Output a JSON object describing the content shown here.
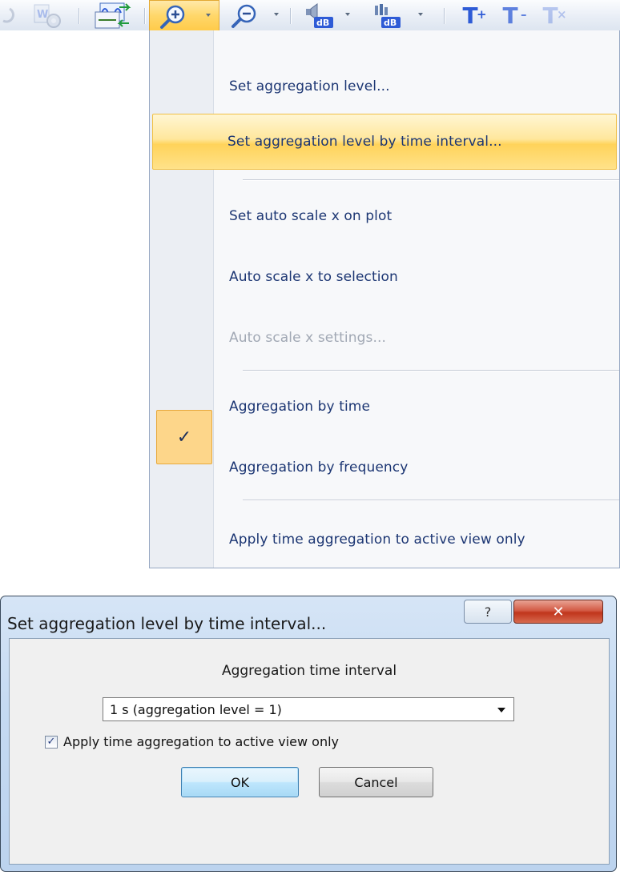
{
  "menu": {
    "items": [
      {
        "label": "Set aggregation level..."
      },
      {
        "label": "Set aggregation level by time interval..."
      },
      {
        "label": "Set auto scale x on plot"
      },
      {
        "label": "Auto scale x to selection"
      },
      {
        "label": "Auto scale x settings..."
      },
      {
        "label": "Aggregation by time"
      },
      {
        "label": "Aggregation by frequency"
      },
      {
        "label": "Apply time aggregation to active view only"
      }
    ],
    "checked_glyph": "✓"
  },
  "dialog": {
    "title": "Set aggregation level by time interval...",
    "help_glyph": "?",
    "close_glyph": "✕",
    "interval_label": "Aggregation time interval",
    "combo_value": "1 s (aggregation level = 1)",
    "checkbox_label": "Apply time aggregation to active view only",
    "checkbox_checked": true,
    "checkbox_glyph": "✓",
    "ok_label": "OK",
    "cancel_label": "Cancel"
  },
  "toolbar": {
    "icons": [
      "undo-icon",
      "word-settings-icon",
      "sine-transfer-icon",
      "zoom-in-icon",
      "zoom-out-icon",
      "speaker-db-icon",
      "equalizer-db-icon",
      "font-increase-icon",
      "font-decrease-icon",
      "font-default-icon"
    ],
    "font_increase_sup": "+",
    "font_decrease_sup": "–",
    "font_default_sup": "×"
  },
  "colors": {
    "menu_hover": "#ffd35a",
    "menu_text": "#1c3673",
    "toolbar_accent": "#2e5bd6",
    "close_button": "#c0351c"
  }
}
